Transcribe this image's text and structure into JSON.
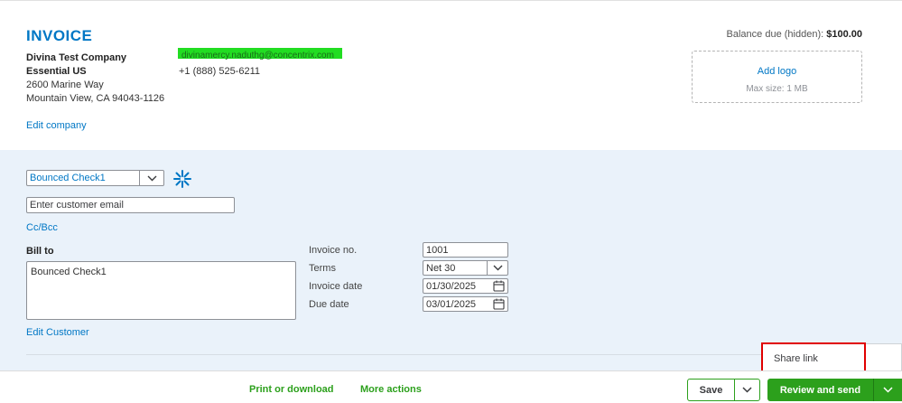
{
  "header": {
    "invoice_title": "INVOICE",
    "company_name": "Divina Test Company Essential US",
    "address_line1": "2600 Marine Way",
    "address_line2": "Mountain View, CA 94043-1126",
    "edit_company": "Edit company",
    "email_redacted": "divinamercy.naduthg@concentrix.com",
    "phone": "+1 (888) 525-6211",
    "balance_label": "Balance due (hidden):",
    "balance_amount": "$100.00",
    "add_logo": "Add logo",
    "logo_max_size": "Max size: 1 MB"
  },
  "customer": {
    "selected": "Bounced Check1",
    "email_placeholder": "Enter customer email",
    "cc_bcc": "Cc/Bcc",
    "bill_to_label": "Bill to",
    "bill_to_value": "Bounced Check1",
    "edit_customer": "Edit Customer"
  },
  "fields": {
    "invoice_no_label": "Invoice no.",
    "invoice_no": "1001",
    "terms_label": "Terms",
    "terms": "Net 30",
    "invoice_date_label": "Invoice date",
    "invoice_date": "01/30/2025",
    "due_date_label": "Due date",
    "due_date": "03/01/2025"
  },
  "popup": {
    "share_link": "Share link"
  },
  "footer": {
    "print_download": "Print or download",
    "more_actions": "More actions",
    "save": "Save",
    "review_send": "Review and send"
  },
  "colors": {
    "link_blue": "#0077c5",
    "green": "#2ca01c",
    "form_bg": "#eaf2fa",
    "highlight_red": "#e00000"
  }
}
